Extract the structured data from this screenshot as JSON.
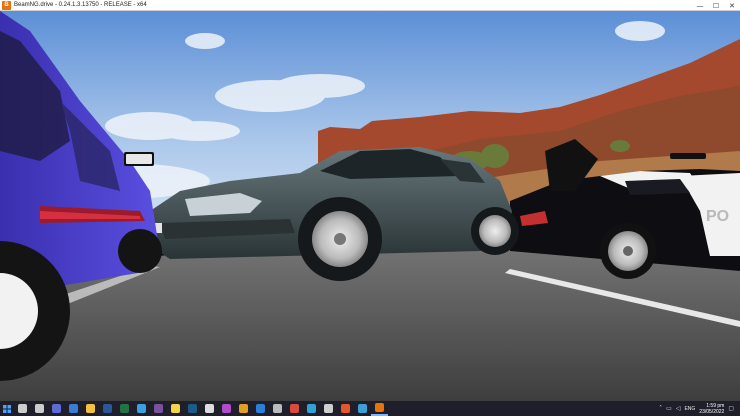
{
  "window": {
    "title": "BeamNG.drive - 0.24.1.3.13750 - RELEASE - x64",
    "controls": {
      "minimize": "—",
      "maximize": "☐",
      "close": "✕"
    }
  },
  "scene": {
    "description_colors": {
      "sky_top": "#5b8fd6",
      "sky_bottom": "#cfe0f2",
      "cliff": "#a4482e",
      "road": "#5a5a5a",
      "purple_car": "#4b3fc7",
      "sedan": "#3d4a4d",
      "police_black": "#0e0e12",
      "police_white": "#f2f2f2"
    },
    "police_text": "PO"
  },
  "taskbar": {
    "icons": [
      {
        "name": "search-icon",
        "color": "#cccccc"
      },
      {
        "name": "task-view-icon",
        "color": "#cccccc"
      },
      {
        "name": "chat-icon",
        "color": "#5d6bd6"
      },
      {
        "name": "camera-icon",
        "color": "#3a7bd5"
      },
      {
        "name": "file-explorer-icon",
        "color": "#f2c23a"
      },
      {
        "name": "word-icon",
        "color": "#2b579a"
      },
      {
        "name": "excel-icon",
        "color": "#217346"
      },
      {
        "name": "store-icon",
        "color": "#3aa0e0"
      },
      {
        "name": "viber-icon",
        "color": "#7b519d"
      },
      {
        "name": "notes-icon",
        "color": "#f5d547"
      },
      {
        "name": "steam-icon",
        "color": "#1b5b8a"
      },
      {
        "name": "epic-icon",
        "color": "#dddddd"
      },
      {
        "name": "app-icon-2",
        "color": "#b04bc9"
      },
      {
        "name": "winamp-icon",
        "color": "#e0a020"
      },
      {
        "name": "app-icon-3",
        "color": "#2a7fd8"
      },
      {
        "name": "settings-icon",
        "color": "#bbbbbb"
      },
      {
        "name": "chrome-icon",
        "color": "#d94b3c"
      },
      {
        "name": "edge-icon",
        "color": "#2fa3d6"
      },
      {
        "name": "app-icon-4",
        "color": "#cfcfcf"
      },
      {
        "name": "app-icon-5",
        "color": "#e5572b"
      },
      {
        "name": "app-icon-6",
        "color": "#3ca0d8"
      },
      {
        "name": "beamng-icon",
        "color": "#e8720c"
      }
    ],
    "tray": {
      "chevron": "˄",
      "language": "ENG",
      "time": "1:59 pm",
      "date": "23/05/2022"
    }
  }
}
